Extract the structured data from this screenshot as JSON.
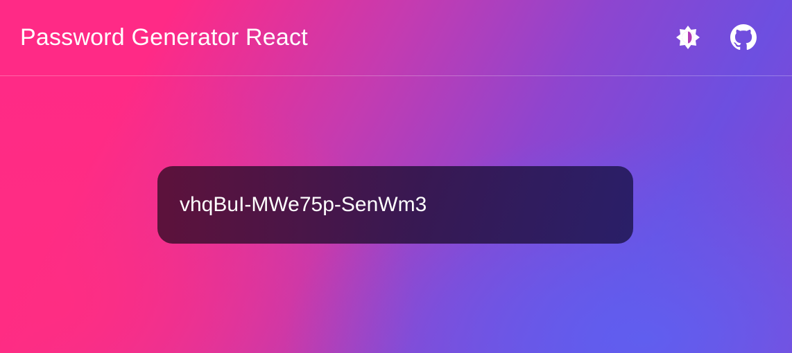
{
  "header": {
    "title": "Password Generator React",
    "theme_toggle_icon": "brightness-icon",
    "github_icon": "github-icon"
  },
  "password": {
    "value": "vhqBuI-MWe75p-SenWm3"
  },
  "colors": {
    "gradient_pink": "#ff2a86",
    "gradient_purple": "#8e45cf",
    "gradient_blue": "#5f5ff0",
    "text": "#ffffff",
    "password_box": "#3a1748"
  }
}
